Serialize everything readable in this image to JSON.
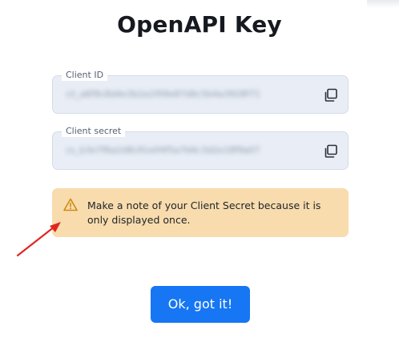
{
  "dialog": {
    "title": "OpenAPI Key",
    "client_id": {
      "label": "Client ID",
      "value": "cli_a6f9c8d4e3b2a1f09e87d6c5b4a3928f71",
      "copy_icon": "copy-icon"
    },
    "client_secret": {
      "label": "Client secret",
      "value": "cs_b3e7f6a2d8c91e04f5a7b6c3d2e18f9a07",
      "copy_icon": "copy-icon"
    },
    "notice": {
      "icon": "warning-triangle-icon",
      "text": "Make a note of your Client Secret because it is only displayed once."
    },
    "confirm_button": "Ok, got it!"
  },
  "colors": {
    "accent": "#1676f3",
    "notice_bg": "#f8dcae",
    "warning": "#d08a12",
    "annotation_arrow": "#e0271f",
    "field_bg": "#e9eef6"
  }
}
